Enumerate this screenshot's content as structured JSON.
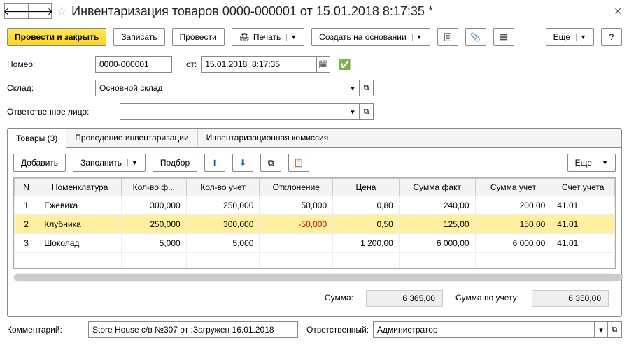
{
  "title": "Инвентаризация товаров 0000-000001 от 15.01.2018 8:17:35 *",
  "toolbar": {
    "primary": "Провести и закрыть",
    "save": "Записать",
    "post": "Провести",
    "print": "Печать",
    "create_from": "Создать на основании",
    "more": "Еще"
  },
  "form": {
    "number_label": "Номер:",
    "number": "0000-000001",
    "date_label": "от:",
    "date": "15.01.2018  8:17:35",
    "warehouse_label": "Склад:",
    "warehouse": "Основной склад",
    "responsible_label": "Ответственное лицо:",
    "responsible": ""
  },
  "tabs": {
    "goods": "Товары (3)",
    "inventory": "Проведение инвентаризации",
    "commission": "Инвентаризационная комиссия"
  },
  "gridToolbar": {
    "add": "Добавить",
    "fill": "Заполнить",
    "pick": "Подбор",
    "more": "Еще"
  },
  "columns": {
    "n": "N",
    "nomenclature": "Номенклатура",
    "qty_fact": "Кол-во ф...",
    "qty_book": "Кол-во учет",
    "deviation": "Отклонение",
    "price": "Цена",
    "sum_fact": "Сумма факт",
    "sum_book": "Сумма учет",
    "account": "Счет учета"
  },
  "rows": [
    {
      "n": "1",
      "name": "Ежевика",
      "qf": "300,000",
      "qb": "250,000",
      "dev": "50,000",
      "price": "0,80",
      "sf": "240,00",
      "sb": "200,00",
      "acc": "41.01",
      "sel": false
    },
    {
      "n": "2",
      "name": "Клубника",
      "qf": "250,000",
      "qb": "300,000",
      "dev": "-50,000",
      "price": "0,50",
      "sf": "125,00",
      "sb": "150,00",
      "acc": "41.01",
      "sel": true
    },
    {
      "n": "3",
      "name": "Шоколад",
      "qf": "5,000",
      "qb": "5,000",
      "dev": "",
      "price": "1 200,00",
      "sf": "6 000,00",
      "sb": "6 000,00",
      "acc": "41.01",
      "sel": false
    }
  ],
  "totals": {
    "sum_label": "Сумма:",
    "sum": "6 365,00",
    "sum_book_label": "Сумма по учету:",
    "sum_book": "6 350,00"
  },
  "bottom": {
    "comment_label": "Комментарий:",
    "comment": "Store House с/в №307 от ;Загружен 16.01.2018",
    "responsible_label": "Ответственный:",
    "responsible": "Администратор"
  }
}
